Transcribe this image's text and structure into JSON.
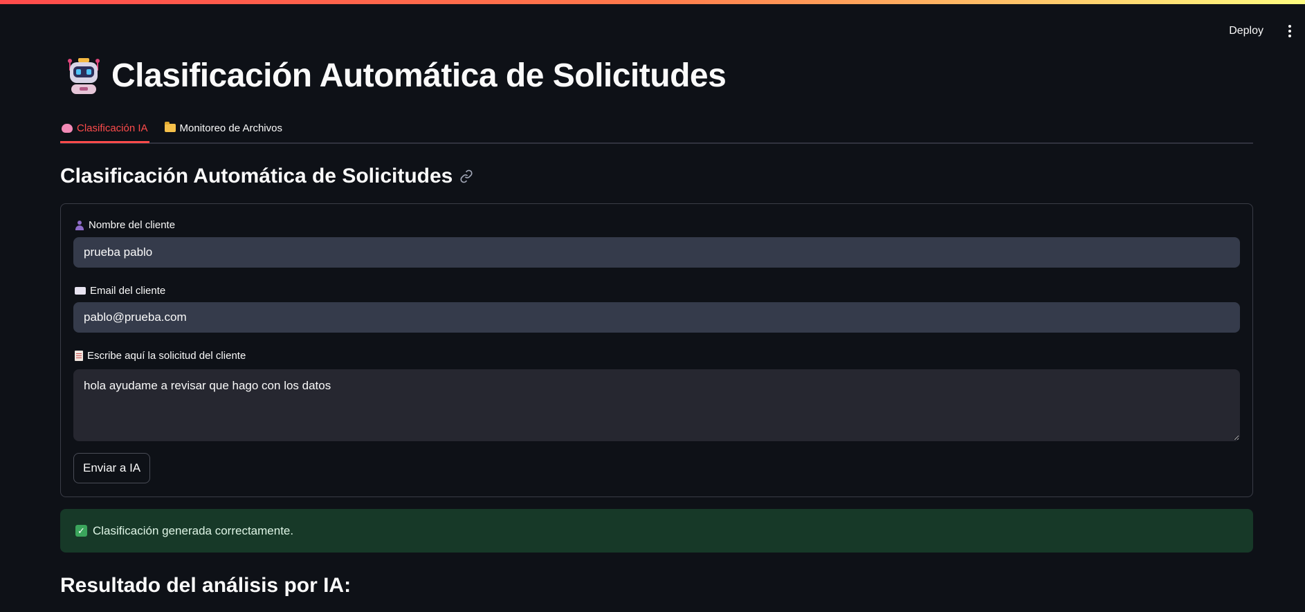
{
  "header": {
    "deploy_label": "Deploy",
    "menu_icon": "kebab-menu-icon"
  },
  "title": {
    "icon": "robot-icon",
    "text": "Clasificación Automática de Solicitudes"
  },
  "tabs": [
    {
      "icon": "brain-icon",
      "label": "Clasificación IA",
      "active": true
    },
    {
      "icon": "folder-icon",
      "label": "Monitoreo de Archivos",
      "active": false
    }
  ],
  "section": {
    "heading": "Clasificación Automática de Solicitudes",
    "anchor_icon": "link-icon"
  },
  "form": {
    "name_label": "Nombre del cliente",
    "name_value": "prueba pablo",
    "email_label": "Email del cliente",
    "email_value": "pablo@prueba.com",
    "request_label": "Escribe aquí la solicitud del cliente",
    "request_value": "hola ayudame a revisar que hago con los datos",
    "submit_label": "Enviar a IA"
  },
  "status": {
    "icon": "check-icon",
    "message": "Clasificación generada correctamente."
  },
  "result": {
    "heading": "Resultado del análisis por IA:"
  },
  "colors": {
    "background": "#0e1117",
    "accent": "#ff4b4b",
    "input_bg": "#353b4b",
    "textarea_bg": "#262730",
    "success_bg": "#173928"
  }
}
